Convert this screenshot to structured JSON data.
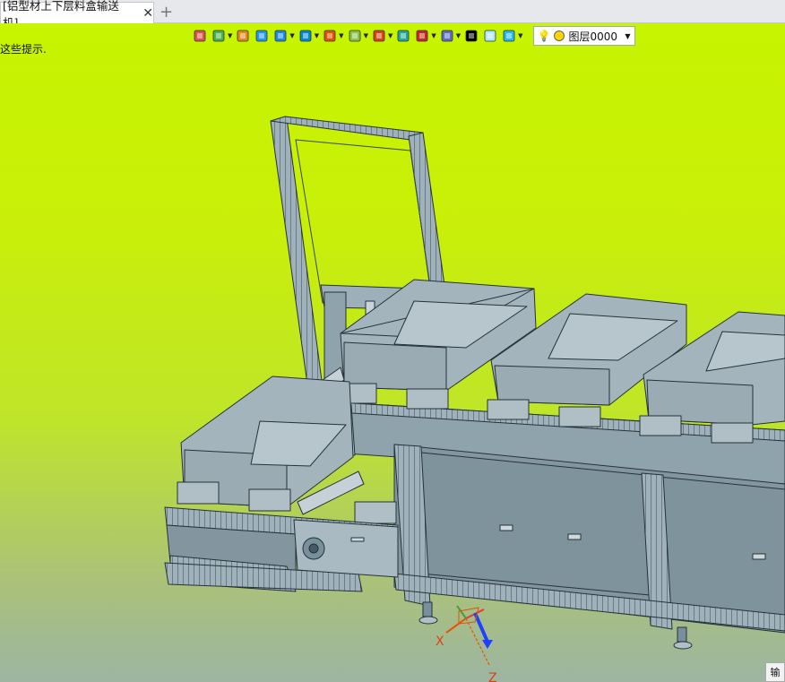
{
  "tab": {
    "title": "[铝型材上下层料盒输送机]",
    "close_glyph": "✕",
    "new_glyph": "+"
  },
  "hint": "这些提示.",
  "toolbar": {
    "items": [
      {
        "name": "sketch-icon",
        "color": "#d9534f",
        "dd": false
      },
      {
        "name": "fillet-icon",
        "color": "#4caf50",
        "dd": true
      },
      {
        "name": "pencil-icon",
        "color": "#e08a20",
        "dd": false
      },
      {
        "name": "box-feature-icon",
        "color": "#2196f3",
        "dd": false
      },
      {
        "name": "solid-icon",
        "color": "#1e88e5",
        "dd": true
      },
      {
        "name": "shell-icon",
        "color": "#0288d1",
        "dd": true
      },
      {
        "name": "sphere-render-icon",
        "color": "#e65100",
        "dd": true
      },
      {
        "name": "frame-icon",
        "color": "#8bc34a",
        "dd": true
      },
      {
        "name": "target-icon",
        "color": "#d84315",
        "dd": true
      },
      {
        "name": "plane-icon",
        "color": "#26a69a",
        "dd": false
      },
      {
        "name": "dimension-icon",
        "color": "#c62828",
        "dd": true
      },
      {
        "name": "render-style-icon",
        "color": "#5c6bc0",
        "dd": true
      },
      {
        "name": "line-color-icon",
        "color": "#000000",
        "dd": false
      },
      {
        "name": "face-color-icon",
        "color": "#b3e5fc",
        "dd": false
      },
      {
        "name": "layer-stack-icon",
        "color": "#29b6f6",
        "dd": true
      }
    ],
    "layer": {
      "label": "图层0000",
      "bulb_color": "#ffd400"
    }
  },
  "triad": {
    "x_label": "X",
    "z_label": "Z"
  },
  "corner_label": "输",
  "colors": {
    "metal": "#8fa3ad",
    "metal_light": "#a7b8c0",
    "metal_dark": "#5f7480",
    "edge": "#263238"
  }
}
